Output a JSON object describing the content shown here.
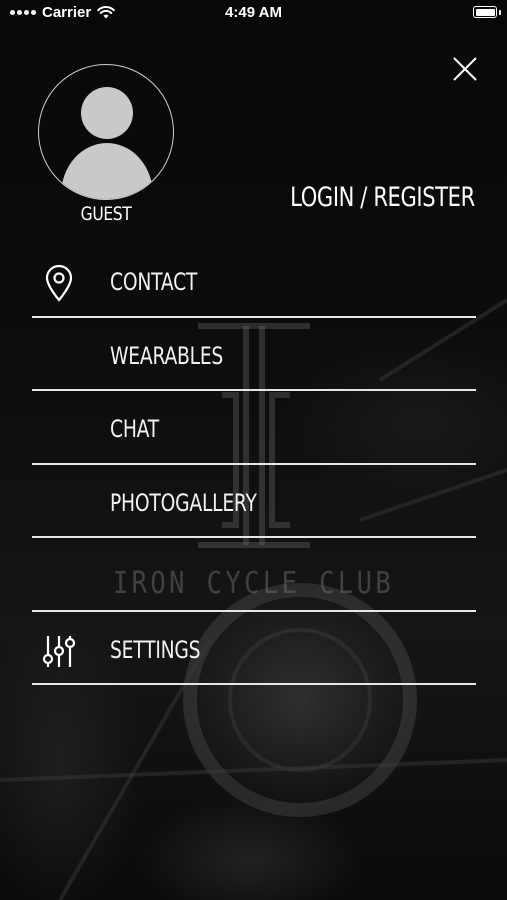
{
  "status_bar": {
    "carrier": "Carrier",
    "time": "4:49 AM",
    "battery_level": 1.0
  },
  "close_icon": "close-icon",
  "user": {
    "avatar_icon": "user-avatar-icon",
    "name": "GUEST"
  },
  "login_label": "LOGIN / REGISTER",
  "menu": {
    "items": [
      {
        "label": "CONTACT",
        "icon": "location-pin-icon"
      },
      {
        "label": "WEARABLES",
        "icon": ""
      },
      {
        "label": "CHAT",
        "icon": ""
      },
      {
        "label": "PHOTOGALLERY",
        "icon": ""
      },
      {
        "label": "",
        "icon": ""
      },
      {
        "label": "SETTINGS",
        "icon": "sliders-icon"
      }
    ]
  },
  "watermark": {
    "brand": "IRON CYCLE CLUB"
  },
  "colors": {
    "background": "#050505",
    "text": "#ffffff",
    "divider": "#e6e6e6"
  }
}
